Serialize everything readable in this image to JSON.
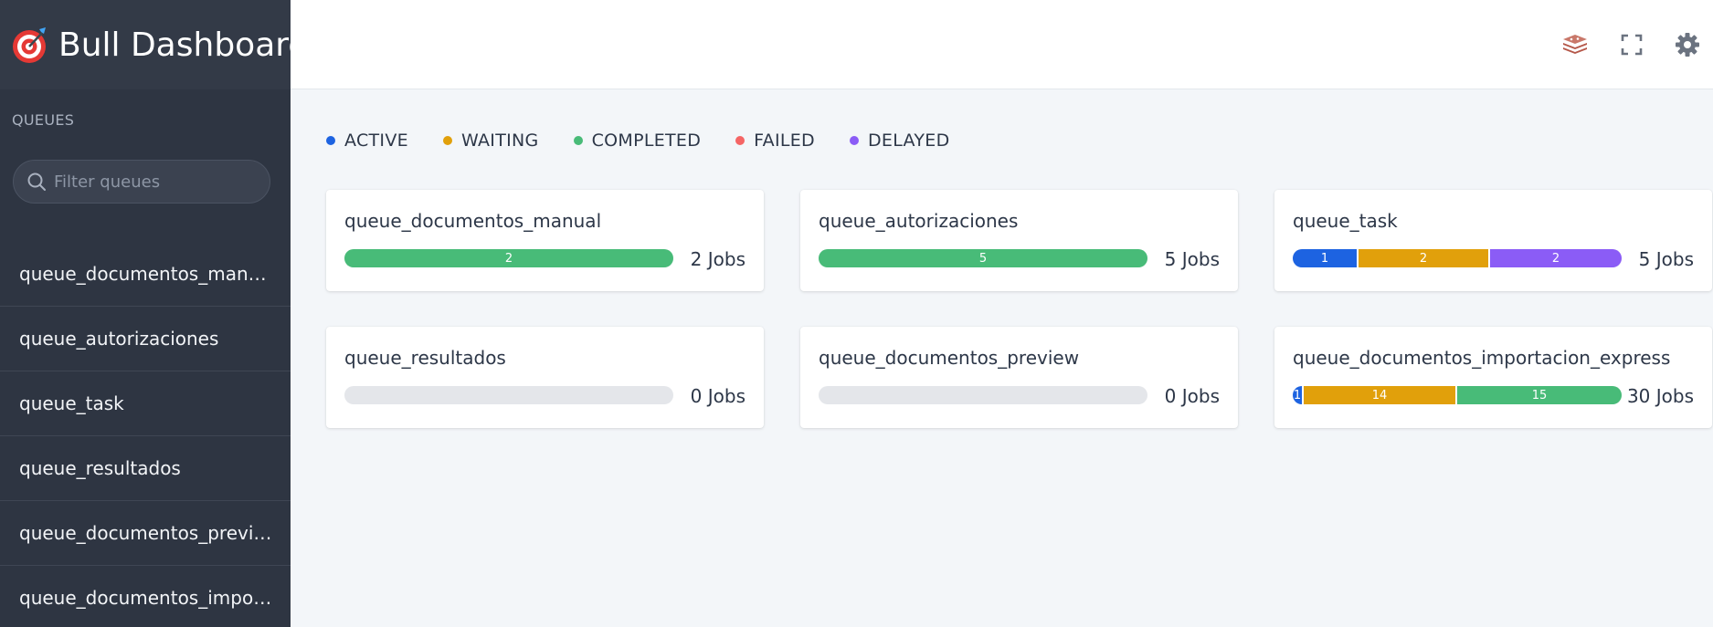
{
  "app": {
    "title": "Bull Dashboard"
  },
  "sidebar": {
    "section_label": "QUEUES",
    "search": {
      "placeholder": "Filter queues",
      "value": ""
    },
    "items": [
      {
        "label": "queue_documentos_manual"
      },
      {
        "label": "queue_autorizaciones"
      },
      {
        "label": "queue_task"
      },
      {
        "label": "queue_resultados"
      },
      {
        "label": "queue_documentos_preview"
      },
      {
        "label": "queue_documentos_import…"
      }
    ]
  },
  "header": {
    "icons": [
      "redis-icon",
      "fullscreen-icon",
      "gear-icon"
    ]
  },
  "legend": [
    {
      "label": "ACTIVE",
      "color": "#1d63e1"
    },
    {
      "label": "WAITING",
      "color": "#e1a00b"
    },
    {
      "label": "COMPLETED",
      "color": "#48bb78"
    },
    {
      "label": "FAILED",
      "color": "#f56565"
    },
    {
      "label": "DELAYED",
      "color": "#8b5cf6"
    }
  ],
  "colors": {
    "active": "#1d63e1",
    "waiting": "#e1a00b",
    "completed": "#48bb78",
    "failed": "#f56565",
    "delayed": "#8b5cf6",
    "sidebar_bg": "#2e3542",
    "page_bg": "#f3f6f9"
  },
  "queues": [
    {
      "name": "queue_documentos_manual",
      "jobs_label": "2 Jobs",
      "total": 2,
      "segments": [
        {
          "status": "completed",
          "count": 2,
          "label": "2"
        }
      ]
    },
    {
      "name": "queue_autorizaciones",
      "jobs_label": "5 Jobs",
      "total": 5,
      "segments": [
        {
          "status": "completed",
          "count": 5,
          "label": "5"
        }
      ]
    },
    {
      "name": "queue_task",
      "jobs_label": "5 Jobs",
      "total": 5,
      "segments": [
        {
          "status": "active",
          "count": 1,
          "label": "1"
        },
        {
          "status": "waiting",
          "count": 2,
          "label": "2"
        },
        {
          "status": "delayed",
          "count": 2,
          "label": "2"
        }
      ]
    },
    {
      "name": "queue_resultados",
      "jobs_label": "0 Jobs",
      "total": 0,
      "segments": []
    },
    {
      "name": "queue_documentos_preview",
      "jobs_label": "0 Jobs",
      "total": 0,
      "segments": []
    },
    {
      "name": "queue_documentos_importacion_express",
      "jobs_label": "30 Jobs",
      "total": 30,
      "segments": [
        {
          "status": "active",
          "count": 1,
          "label": "1"
        },
        {
          "status": "waiting",
          "count": 14,
          "label": "14"
        },
        {
          "status": "completed",
          "count": 15,
          "label": "15"
        }
      ]
    }
  ]
}
